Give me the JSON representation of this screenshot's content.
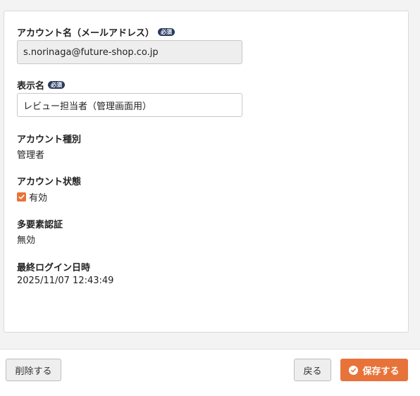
{
  "form": {
    "account_name": {
      "label": "アカウント名（メールアドレス）",
      "required_badge": "必須",
      "value": "s.norinaga@future-shop.co.jp"
    },
    "display_name": {
      "label": "表示名",
      "required_badge": "必須",
      "value": "レビュー担当者（管理画面用）"
    },
    "account_type": {
      "label": "アカウント種別",
      "value": "管理者"
    },
    "account_status": {
      "label": "アカウント状態",
      "checkbox_label": "有効",
      "checked": true
    },
    "mfa": {
      "label": "多要素認証",
      "value": "無効"
    },
    "last_login": {
      "label": "最終ログイン日時",
      "value": "2025/11/07 12:43:49"
    }
  },
  "footer": {
    "delete_label": "削除する",
    "back_label": "戻る",
    "save_label": "保存する"
  },
  "colors": {
    "accent": "#e8733a",
    "badge": "#283a5e",
    "readonly_bg": "#eeeeee"
  },
  "icons": {
    "checkbox": "check-icon",
    "save": "check-circle-icon"
  }
}
